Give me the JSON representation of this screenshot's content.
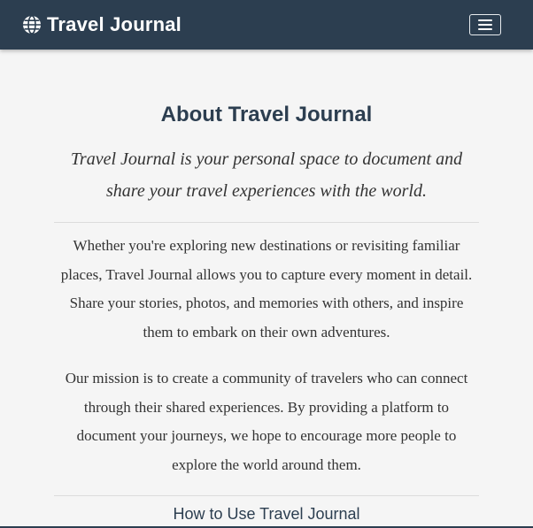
{
  "navbar": {
    "brand_icon": "globe-icon",
    "brand_title": "Travel Journal",
    "menu_icon": "hamburger-menu-icon",
    "background_color": "#2c3e50"
  },
  "about": {
    "title": "About Travel Journal",
    "lead": "Travel Journal is your personal space to document and share your travel experiences with the world.",
    "paragraphs": [
      "Whether you're exploring new destinations or revisiting familiar places, Travel Journal allows you to capture every moment in detail. Share your stories, photos, and memories with others, and inspire them to embark on their own adventures.",
      "Our mission is to create a community of travelers who can connect through their shared experiences. By providing a platform to document your journeys, we hope to encourage more people to explore the world around them."
    ],
    "next_heading": "How to Use Travel Journal"
  }
}
